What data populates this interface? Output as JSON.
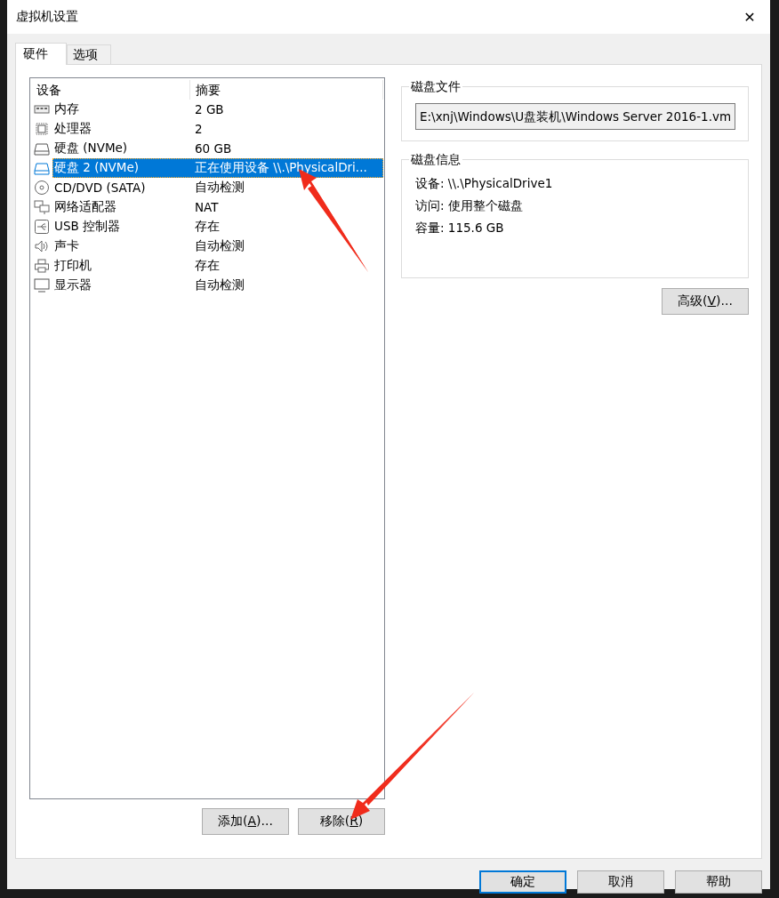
{
  "window": {
    "title": "虚拟机设置",
    "close": "✕"
  },
  "tabs": [
    {
      "label": "硬件",
      "selected": true
    },
    {
      "label": "选项",
      "selected": false
    }
  ],
  "device_list": {
    "columns": [
      "设备",
      "摘要"
    ],
    "rows": [
      {
        "kind": "memory",
        "device": "内存",
        "summary": "2 GB",
        "selected": false
      },
      {
        "kind": "cpu",
        "device": "处理器",
        "summary": "2",
        "selected": false
      },
      {
        "kind": "disk",
        "device": "硬盘 (NVMe)",
        "summary": "60 GB",
        "selected": false
      },
      {
        "kind": "disk",
        "device": "硬盘 2 (NVMe)",
        "summary": "正在使用设备 \\\\.\\PhysicalDri...",
        "selected": true
      },
      {
        "kind": "cdrom",
        "device": "CD/DVD (SATA)",
        "summary": "自动检测",
        "selected": false
      },
      {
        "kind": "network",
        "device": "网络适配器",
        "summary": "NAT",
        "selected": false
      },
      {
        "kind": "usb",
        "device": "USB 控制器",
        "summary": "存在",
        "selected": false
      },
      {
        "kind": "sound",
        "device": "声卡",
        "summary": "自动检测",
        "selected": false
      },
      {
        "kind": "printer",
        "device": "打印机",
        "summary": "存在",
        "selected": false
      },
      {
        "kind": "display",
        "device": "显示器",
        "summary": "自动检测",
        "selected": false
      }
    ]
  },
  "list_buttons": [
    {
      "before": "添加(",
      "access_key": "A",
      "after": ")..."
    },
    {
      "before": "移除(",
      "access_key": "R",
      "after": ")"
    }
  ],
  "disk_file": {
    "title": "磁盘文件",
    "value": "E:\\xnj\\Windows\\U盘装机\\Windows Server 2016-1.vm"
  },
  "disk_info": {
    "title": "磁盘信息",
    "lines": [
      "设备: \\\\.\\PhysicalDrive1",
      "访问: 使用整个磁盘",
      "容量: 115.6 GB"
    ]
  },
  "advanced_button": {
    "before": "高级(",
    "access_key": "V",
    "after": ")..."
  },
  "dialog_buttons": [
    {
      "text": "确定",
      "default": true
    },
    {
      "text": "取消",
      "default": false
    },
    {
      "text": "帮助",
      "default": false
    }
  ]
}
